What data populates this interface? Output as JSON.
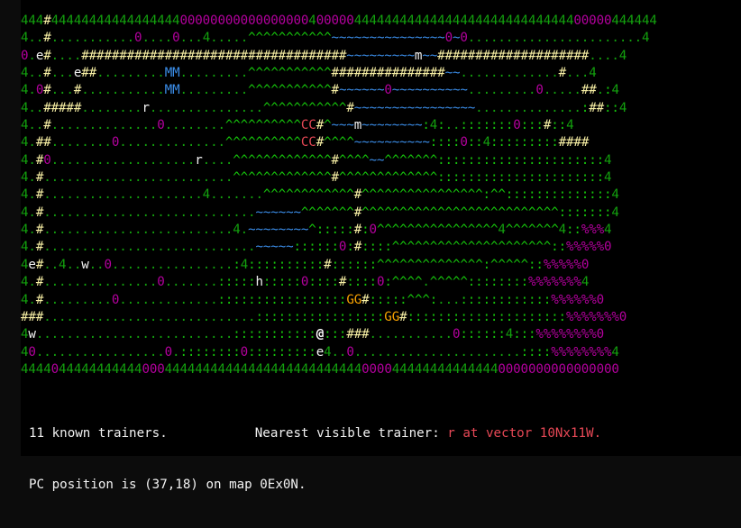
{
  "map_rows": [
    "444#44444444444444444000000000000000004000004444444444444444444444444444400000444444",
    "4..#...........0....0...4.....^^^^^^^^^^^~~~~~~~~~~~~~~~0~0.......................4",
    "0.e#....###################################~~~~~~~~~m~~####################....4",
    "4..#...e##.........MM.........^^^^^^^^^^^###############~~.............#...4",
    "4.0#...#...........MM.........^^^^^^^^^^^#~~~~~~0~~~~~~~~~~.........0.....##.:4",
    "4..#####........r...............^^^^^^^^^^^#~~~~~~~~~~~~~~~~..............:##::4",
    "4..#..............0........^^^^^^^^^^CC#^~~~m~~~~~~~~:4:..:::::::0:::#::4",
    "4.##........0..............^^^^^^^^^^CC#^^^^~~~~~~~~~~::::0::4:::::::::####",
    "4.#0...................r....^^^^^^^^^^^^^#^^^^~~^^^^^^^::::::::::::::::::::::4",
    "4.#.........................^^^^^^^^^^^^^#^^^^^^^^^^^^^::::::::::::::::::::::4",
    "4.#.....................4.......^^^^^^^^^^^^#^^^^^^^^^^^^^^^^:^^::::::::::::::4",
    "4.#............................~~~~~~^^^^^^^#^^^^^^^^^^^^^^^^^^^^^^^^^^:::::::4",
    "4.#.........................4.~~~~~~~~^:::::#:0^^^^^^^^^^^^^^^^4^^^^^^^4::%%%4",
    "4.#............................~~~~~::::::0:#::::^^^^^^^^^^^^^^^^^^^^^::%%%%%0",
    "4e#..4..w..0................:4::::::::::#::::::^^^^^^^^^^^^^^:^^^^^::%%%%%0",
    "4.#...............0.......:::::h:::::0::::#::::0:^^^^.^^^^^::::::::%%%%%%%4",
    "4.#.........0.............:::::::::::::::::GG#:::::^^^:...::::::::::::%%%%%%0",
    "###............................:::::::::::::::::GG#:::::::::::::::::::::%%%%%%%0",
    "4w..........................:::::::::::@:::###...........0::::::4:::%%%%%%%%0",
    "40.................0.::::::::0:::::::::e4..0......................::::%%%%%%%%4",
    "4444044444444444000444444444444444444444444440000444444444444440000000000000000"
  ],
  "legend_colors": {
    "trainer": "#f2f2f2",
    "player": "#ffffff",
    "mart": "#3b8eea",
    "center": "#e74856",
    "gym": "#f7a200",
    "road": "#f9f1a5",
    "water": "#3b8eea",
    "grass": "#16c60c",
    "tall_grass": "#b4009e",
    "boulder": "#b4009e",
    "tree": "#13a10e"
  },
  "status": {
    "known_trainers": "11 known trainers.",
    "nearest_label": "Nearest visible trainer:",
    "nearest_value": "r at vector 10Nx11W.",
    "pc_position": "PC position is (37,18) on map 0Ex0N."
  }
}
